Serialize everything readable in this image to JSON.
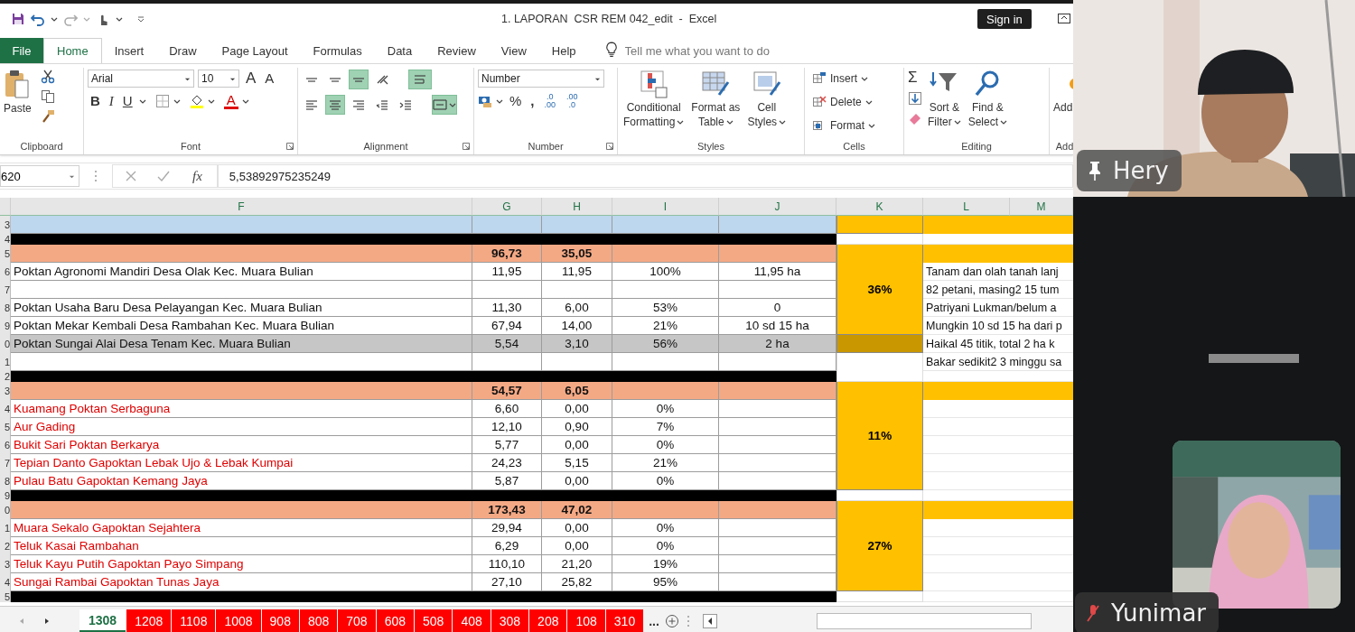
{
  "title_bar": {
    "title": "1. LAPORAN  CSR REM 042_edit  -  Excel",
    "sign_in": "Sign in"
  },
  "tabs": [
    {
      "label": "File",
      "kind": "file",
      "selected": false
    },
    {
      "label": "Home",
      "kind": "tab",
      "selected": true
    },
    {
      "label": "Insert",
      "kind": "tab",
      "selected": false
    },
    {
      "label": "Draw",
      "kind": "tab",
      "selected": false
    },
    {
      "label": "Page Layout",
      "kind": "tab",
      "selected": false
    },
    {
      "label": "Formulas",
      "kind": "tab",
      "selected": false
    },
    {
      "label": "Data",
      "kind": "tab",
      "selected": false
    },
    {
      "label": "Review",
      "kind": "tab",
      "selected": false
    },
    {
      "label": "View",
      "kind": "tab",
      "selected": false
    },
    {
      "label": "Help",
      "kind": "tab",
      "selected": false
    }
  ],
  "tell_me": {
    "placeholder": "Tell me what you want to do"
  },
  "ribbon": {
    "clipboard": {
      "paste": "Paste",
      "label": "Clipboard"
    },
    "font": {
      "family": "Arial",
      "size": "10",
      "grow": "A",
      "shrink": "A",
      "bold": "B",
      "italic": "I",
      "underline": "U",
      "color_letter": "A",
      "label": "Font"
    },
    "alignment": {
      "rows": [
        [
          {
            "kind": "top",
            "selected": false
          },
          {
            "kind": "middle",
            "selected": false
          },
          {
            "kind": "bottom",
            "selected": true
          },
          {
            "kind": "orientation",
            "selected": false
          },
          {
            "kind": "wrap",
            "selected": true
          }
        ],
        [
          {
            "kind": "left",
            "selected": false
          },
          {
            "kind": "center",
            "selected": true
          },
          {
            "kind": "right",
            "selected": false
          },
          {
            "kind": "outdent",
            "selected": false
          },
          {
            "kind": "indent",
            "selected": false
          },
          {
            "kind": "merge",
            "selected": true
          }
        ]
      ],
      "label": "Alignment"
    },
    "number": {
      "format": "Number",
      "percent": "%",
      "comma": ",",
      "decimals": [
        {
          "top": ".0",
          "bottom": ".00"
        },
        {
          "top": ".00",
          "bottom": ".0"
        }
      ],
      "label": "Number"
    },
    "styles": {
      "buttons": [
        {
          "kind": "conditional",
          "line1": "Conditional",
          "line2": "Formatting"
        },
        {
          "kind": "table",
          "line1": "Format as",
          "line2": "Table"
        },
        {
          "kind": "cellstyle",
          "line1": "Cell",
          "line2": "Styles"
        }
      ],
      "label": "Styles"
    },
    "cells": {
      "buttons": [
        {
          "kind": "insert",
          "label": "Insert"
        },
        {
          "kind": "delete",
          "label": "Delete"
        },
        {
          "kind": "format",
          "label": "Format"
        }
      ],
      "label": "Cells"
    },
    "editing": {
      "sum": "Σ",
      "buttons": [
        {
          "kind": "sort",
          "line1": "Sort &",
          "line2": "Filter"
        },
        {
          "kind": "find",
          "line1": "Find &",
          "line2": "Select"
        }
      ],
      "label": "Editing"
    },
    "add_ins": {
      "line1": "Add",
      "label": "Add"
    }
  },
  "formula_bar": {
    "name_box": "620",
    "fx": "fx",
    "value": "5,53892975235249"
  },
  "sheet": {
    "columns": [
      "F",
      "G",
      "H",
      "I",
      "J",
      "K",
      "L",
      "M"
    ],
    "rows": [
      {
        "number": "3",
        "kind": "blue",
        "selected": false,
        "note_band": true,
        "k_filled": true
      },
      {
        "number": "4",
        "kind": "black",
        "selected": false,
        "note_band": false,
        "k_filled": false
      },
      {
        "number": "5",
        "kind": "salmon",
        "selected": false,
        "note_band": true,
        "k_filled": true,
        "k_text": "36%",
        "g": "96,73",
        "h": "35,05"
      },
      {
        "number": "6",
        "kind": "data",
        "selected": false,
        "red": false,
        "note_band": false,
        "k_filled": true,
        "name": "Poktan Agronomi Mandiri Desa Olak Kec. Muara Bulian",
        "g": "11,95",
        "h": "11,95",
        "i": "100%",
        "j": "11,95 ha",
        "note": "Tanam dan olah tanah lanj"
      },
      {
        "number": "7",
        "kind": "data",
        "selected": false,
        "note_band": false,
        "k_filled": true,
        "note": "82 petani, masing2 15 tum"
      },
      {
        "number": "8",
        "kind": "data",
        "selected": false,
        "red": false,
        "note_band": false,
        "k_filled": true,
        "name": "Poktan Usaha Baru Desa Pelayangan Kec. Muara Bulian",
        "g": "11,30",
        "h": "6,00",
        "i": "53%",
        "j": "0",
        "note": "Patriyani Lukman/belum a"
      },
      {
        "number": "9",
        "kind": "data",
        "selected": false,
        "red": false,
        "note_band": false,
        "k_filled": true,
        "name": "Poktan Mekar Kembali Desa Rambahan Kec. Muara Bulian",
        "g": "67,94",
        "h": "14,00",
        "i": "21%",
        "j": "10 sd 15 ha",
        "note": "Mungkin 10 sd 15 ha dari p"
      },
      {
        "number": "0",
        "kind": "data",
        "selected": true,
        "red": false,
        "note_band": false,
        "k_filled": true,
        "name": "Poktan Sungai Alai Desa Tenam Kec. Muara Bulian",
        "g": "5,54",
        "h": "3,10",
        "i": "56%",
        "j": "2 ha",
        "note": "Haikal 45 titik, total 2 ha k"
      },
      {
        "number": "1",
        "kind": "data",
        "selected": false,
        "note_band": false,
        "k_filled": false,
        "note": "Bakar sedikit2 3 minggu sa"
      },
      {
        "number": "2",
        "kind": "black",
        "selected": false,
        "note_band": false,
        "k_filled": false
      },
      {
        "number": "3",
        "kind": "salmon",
        "selected": false,
        "note_band": true,
        "k_filled": true,
        "k_text": "11%",
        "g": "54,57",
        "h": "6,05"
      },
      {
        "number": "4",
        "kind": "data",
        "selected": false,
        "red": true,
        "note_band": false,
        "k_filled": true,
        "name": "Kuamang Poktan Serbaguna",
        "g": "6,60",
        "h": "0,00",
        "i": "0%"
      },
      {
        "number": "5",
        "kind": "data",
        "selected": false,
        "red": true,
        "note_band": false,
        "k_filled": true,
        "name": "Aur Gading",
        "g": "12,10",
        "h": "0,90",
        "i": "7%"
      },
      {
        "number": "6",
        "kind": "data",
        "selected": false,
        "red": true,
        "note_band": false,
        "k_filled": true,
        "name": "Bukit Sari Poktan Berkarya",
        "g": "5,77",
        "h": "0,00",
        "i": "0%"
      },
      {
        "number": "7",
        "kind": "data",
        "selected": false,
        "red": true,
        "note_band": false,
        "k_filled": true,
        "name": "Tepian Danto Gapoktan Lebak Ujo & Lebak Kumpai",
        "g": "24,23",
        "h": "5,15",
        "i": "21%"
      },
      {
        "number": "8",
        "kind": "data",
        "selected": false,
        "red": true,
        "note_band": false,
        "k_filled": true,
        "name": "Pulau Batu Gapoktan Kemang Jaya",
        "g": "5,87",
        "h": "0,00",
        "i": "0%"
      },
      {
        "number": "9",
        "kind": "black",
        "selected": false,
        "note_band": false,
        "k_filled": false
      },
      {
        "number": "0",
        "kind": "salmon",
        "selected": false,
        "note_band": true,
        "k_filled": true,
        "k_text": "27%",
        "g": "173,43",
        "h": "47,02"
      },
      {
        "number": "1",
        "kind": "data",
        "selected": false,
        "red": true,
        "note_band": false,
        "k_filled": true,
        "name": "Muara Sekalo Gapoktan Sejahtera",
        "g": "29,94",
        "h": "0,00",
        "i": "0%"
      },
      {
        "number": "2",
        "kind": "data",
        "selected": false,
        "red": true,
        "note_band": false,
        "k_filled": true,
        "name": "Teluk Kasai Rambahan",
        "g": "6,29",
        "h": "0,00",
        "i": "0%"
      },
      {
        "number": "3",
        "kind": "data",
        "selected": false,
        "red": true,
        "note_band": false,
        "k_filled": true,
        "name": "Teluk Kayu Putih Gapoktan Payo Simpang",
        "g": "110,10",
        "h": "21,20",
        "i": "19%"
      },
      {
        "number": "4",
        "kind": "data",
        "selected": false,
        "red": true,
        "note_band": false,
        "k_filled": true,
        "name": "Sungai Rambai Gapoktan Tunas Jaya",
        "g": "27,10",
        "h": "25,82",
        "i": "95%"
      },
      {
        "number": "5",
        "kind": "black",
        "selected": false,
        "note_band": false,
        "k_filled": false
      }
    ]
  },
  "sheet_tabs": [
    {
      "label": "1308",
      "selected": true
    },
    {
      "label": "1208",
      "selected": false
    },
    {
      "label": "1108",
      "selected": false
    },
    {
      "label": "1008",
      "selected": false
    },
    {
      "label": "908",
      "selected": false
    },
    {
      "label": "808",
      "selected": false
    },
    {
      "label": "708",
      "selected": false
    },
    {
      "label": "608",
      "selected": false
    },
    {
      "label": "508",
      "selected": false
    },
    {
      "label": "408",
      "selected": false
    },
    {
      "label": "308",
      "selected": false
    },
    {
      "label": "208",
      "selected": false
    },
    {
      "label": "108",
      "selected": false
    },
    {
      "label": "310",
      "selected": false
    }
  ],
  "more_tabs": "...",
  "call": {
    "participants": [
      {
        "name": "Hery",
        "pinned": true,
        "muted": false,
        "kind": "main"
      },
      {
        "name": "Yunimar",
        "pinned": false,
        "muted": true,
        "kind": "self"
      }
    ]
  }
}
